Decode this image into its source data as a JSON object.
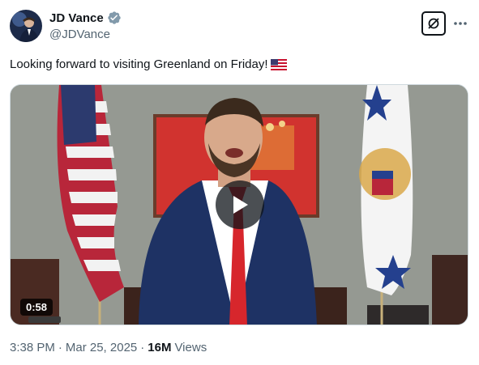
{
  "author": {
    "display_name": "JD Vance",
    "handle": "@JDVance",
    "verified_icon": "verified-badge-icon"
  },
  "tweet": {
    "text": "Looking forward to visiting Greenland on Friday!",
    "emoji": "us-flag-emoji"
  },
  "video": {
    "duration": "0:58",
    "play_icon": "play-icon"
  },
  "meta": {
    "time": "3:38 PM",
    "separator": "·",
    "date": "Mar 25, 2025",
    "views_count": "16M",
    "views_label": "Views"
  },
  "actions": {
    "grok_icon": "grok-icon",
    "more_icon": "more-icon"
  },
  "colors": {
    "text_primary": "#0f1419",
    "text_secondary": "#536471",
    "verified": "#829aab",
    "border": "#cfd9de"
  }
}
